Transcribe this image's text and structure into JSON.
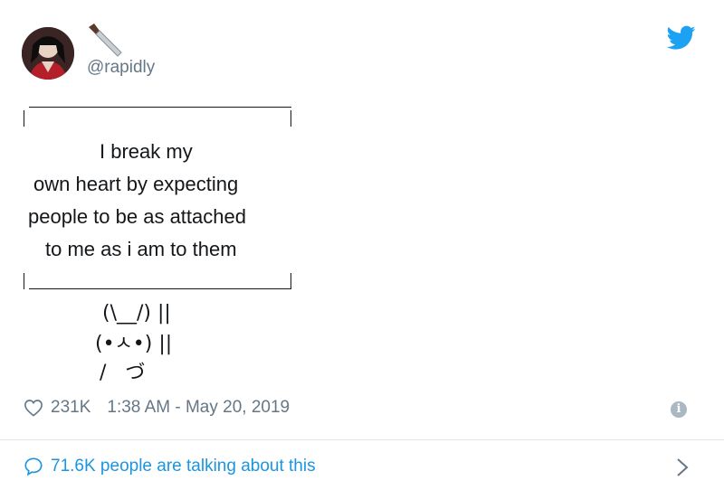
{
  "tweet": {
    "handle": "@rapidly",
    "lines": [
      "I break my",
      "own heart by expecting",
      "people to be as attached",
      "to me as i am to them"
    ],
    "art": [
      "(\\__/) ||",
      "(•ㅅ•) ||",
      "/   づ"
    ],
    "likes": "231K",
    "timestamp": "1:38 AM - May 20, 2019",
    "talking": "71.6K people are talking about this"
  },
  "colors": {
    "brand": "#1da1f2",
    "muted": "#657786",
    "link": "#1b95e0"
  },
  "icons": [
    "avatar",
    "knife-icon",
    "twitter-bird-icon",
    "heart-icon",
    "info-icon",
    "comment-bubble-icon",
    "chevron-right-icon"
  ]
}
